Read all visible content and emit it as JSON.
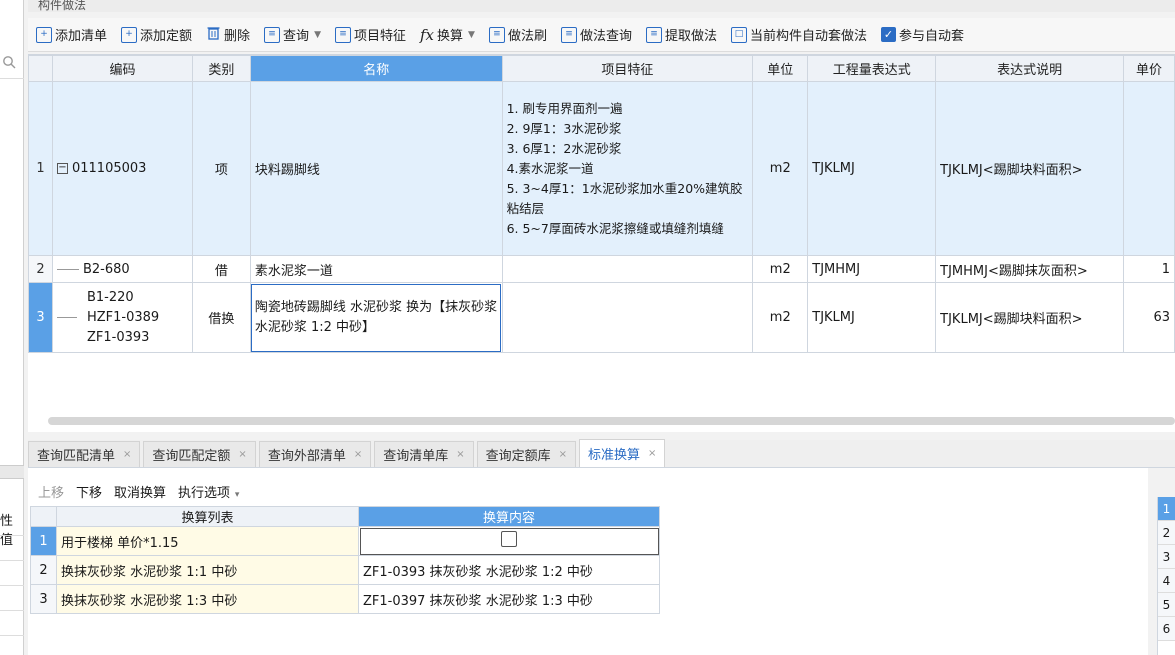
{
  "panel_title": "构件做法",
  "left_label": "性值",
  "toolbar": {
    "add_list": "添加清单",
    "add_quota": "添加定额",
    "delete": "删除",
    "query": "查询",
    "item_feature": "项目特征",
    "convert": "换算",
    "method_brush": "做法刷",
    "method_query": "做法查询",
    "extract_method": "提取做法",
    "auto_apply": "当前构件自动套做法",
    "participate_auto": "参与自动套"
  },
  "grid": {
    "headers": [
      "编码",
      "类别",
      "名称",
      "项目特征",
      "单位",
      "工程量表达式",
      "表达式说明",
      "单价"
    ],
    "rows": [
      {
        "num": "1",
        "code": "011105003",
        "type": "项",
        "name": "块料踢脚线",
        "feature": "1. 刷专用界面剂一遍\n2. 9厚1：3水泥砂浆\n3. 6厚1：2水泥砂浆\n4.素水泥浆一道\n5. 3~4厚1：1水泥砂浆加水重20%建筑胶粘结层\n6. 5~7厚面砖水泥浆擦缝或填缝剂填缝",
        "unit": "m2",
        "expr": "TJKLMJ",
        "expr_desc": "TJKLMJ<踢脚块料面积>",
        "price": ""
      },
      {
        "num": "2",
        "code": "B2-680",
        "type": "借",
        "name": "素水泥浆一道",
        "feature": "",
        "unit": "m2",
        "expr": "TJMHMJ",
        "expr_desc": "TJMHMJ<踢脚抹灰面积>",
        "price": "1"
      },
      {
        "num": "3",
        "code_lines": [
          "B1-220",
          "HZF1-0389",
          "ZF1-0393"
        ],
        "type": "借换",
        "name": "陶瓷地砖踢脚线 水泥砂浆  换为【抹灰砂浆 水泥砂浆 1:2 中砂】",
        "feature": "",
        "unit": "m2",
        "expr": "TJKLMJ",
        "expr_desc": "TJKLMJ<踢脚块料面积>",
        "price": "63"
      }
    ]
  },
  "tabs": [
    "查询匹配清单",
    "查询匹配定额",
    "查询外部清单",
    "查询清单库",
    "查询定额库",
    "标准换算"
  ],
  "sub_toolbar": {
    "up": "上移",
    "down": "下移",
    "cancel_convert": "取消换算",
    "exec_options": "执行选项"
  },
  "conversion": {
    "headers": [
      "换算列表",
      "换算内容"
    ],
    "rows": [
      {
        "num": "1",
        "list": "用于楼梯 单价*1.15",
        "content": ""
      },
      {
        "num": "2",
        "list": "换抹灰砂浆 水泥砂浆 1:1 中砂",
        "content": "ZF1-0393  抹灰砂浆 水泥砂浆 1:2 中砂"
      },
      {
        "num": "3",
        "list": "换抹灰砂浆 水泥砂浆 1:3 中砂",
        "content": "ZF1-0397  抹灰砂浆 水泥砂浆 1:3 中砂"
      }
    ]
  },
  "right_rows": [
    "1",
    "2",
    "3",
    "4",
    "5",
    "6"
  ]
}
